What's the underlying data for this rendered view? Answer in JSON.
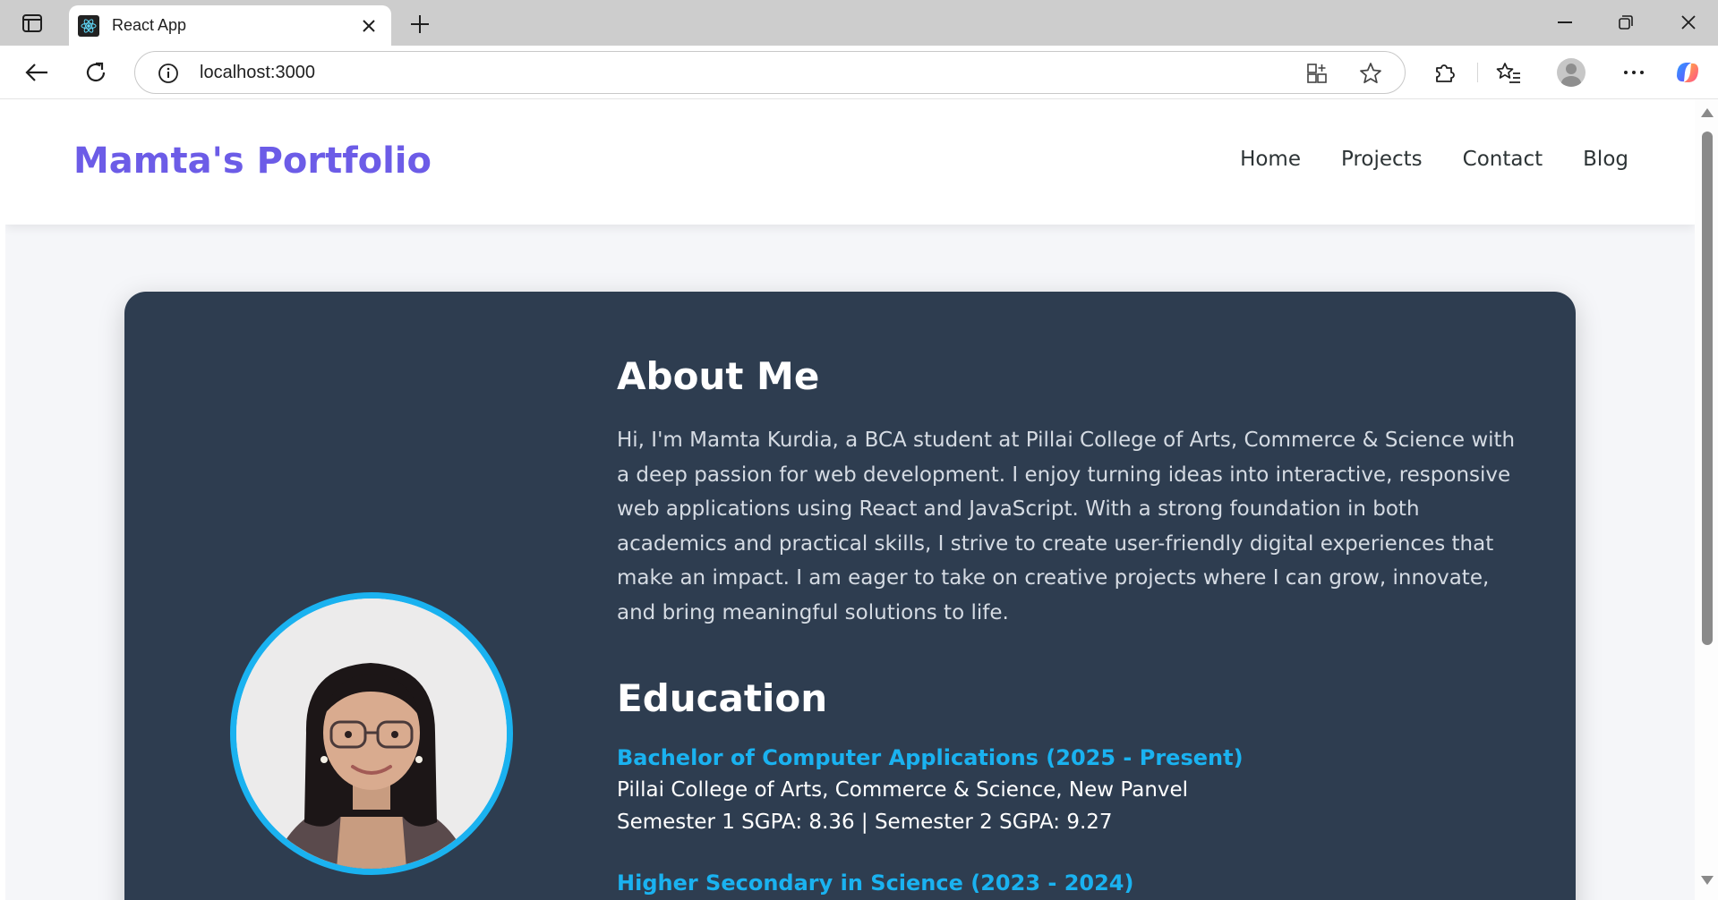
{
  "browser": {
    "tab_title": "React App",
    "url": "localhost:3000"
  },
  "site": {
    "logo": "Mamta's Portfolio",
    "nav": [
      "Home",
      "Projects",
      "Contact",
      "Blog"
    ]
  },
  "about": {
    "heading": "About Me",
    "paragraph": "Hi, I'm Mamta Kurdia, a BCA student at Pillai College of Arts, Commerce & Science with a deep passion for web development. I enjoy turning ideas into interactive, responsive web applications using React and JavaScript. With a strong foundation in both academics and practical skills, I strive to create user-friendly digital experiences that make an impact. I am eager to take on creative projects where I can grow, innovate, and bring meaningful solutions to life."
  },
  "education": {
    "heading": "Education",
    "items": [
      {
        "title": "Bachelor of Computer Applications (2025 - Present)",
        "institution": "Pillai College of Arts, Commerce & Science, New Panvel",
        "scores": "Semester 1 SGPA: 8.36 | Semester 2 SGPA: 9.27"
      },
      {
        "title": "Higher Secondary in Science (2023 - 2024)"
      }
    ]
  },
  "colors": {
    "brand": "#6c5ce7",
    "card_bg": "#2e3d50",
    "accent": "#1ab2f0"
  }
}
